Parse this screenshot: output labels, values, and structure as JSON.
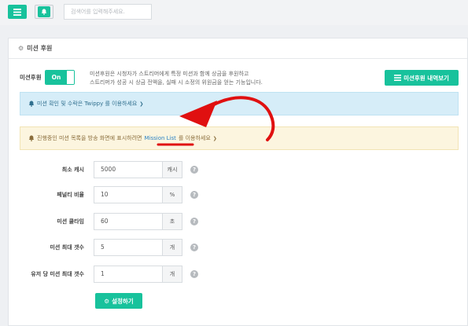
{
  "topbar": {
    "menu_icon": "hamburger-icon",
    "bell_icon": "bell-icon",
    "search_placeholder": "검색어를 입력해주세요."
  },
  "panel": {
    "title_icon": "gear-icon",
    "title": "미션 후원"
  },
  "toggle": {
    "label": "미션후원",
    "state": "On"
  },
  "description": {
    "line1": "미션후원은 시청자가 스트리머에게 특정 미션과 함께 상금을 후원하고",
    "line2": "스트리머가 성공 시 상금 전액을, 실패 시 소정의 위원금을 얻는 기능입니다."
  },
  "history_button": {
    "icon": "list-icon",
    "label": "미션후원 내역보기"
  },
  "alert_info": {
    "icon": "bell-icon",
    "text": "미션 확인 및 수락은 Twippy 를 이용하세요",
    "chevron": "❯"
  },
  "alert_warning": {
    "icon": "bell-icon",
    "text_before": "진행중인 미션 목록을 방송 화면에 표시하려면",
    "link": "Mission List",
    "text_after": "를 이용하세요",
    "chevron": "❯"
  },
  "form": {
    "rows": [
      {
        "label": "최소 캐시",
        "value": "5000",
        "unit": "캐시"
      },
      {
        "label": "페널티 비율",
        "value": "10",
        "unit": "%"
      },
      {
        "label": "미션 쿨타임",
        "value": "60",
        "unit": "초"
      },
      {
        "label": "미션 최대 갯수",
        "value": "5",
        "unit": "개"
      },
      {
        "label": "유저 당 미션 최대 갯수",
        "value": "1",
        "unit": "개"
      }
    ],
    "help_glyph": "?"
  },
  "submit_button": {
    "icon": "gear-icon",
    "label": "설정하기"
  },
  "colors": {
    "accent": "#18c29c",
    "info_bg": "#d6edf8",
    "warning_bg": "#fcf5df",
    "link": "#2c83c5",
    "annotation": "#e01010"
  }
}
